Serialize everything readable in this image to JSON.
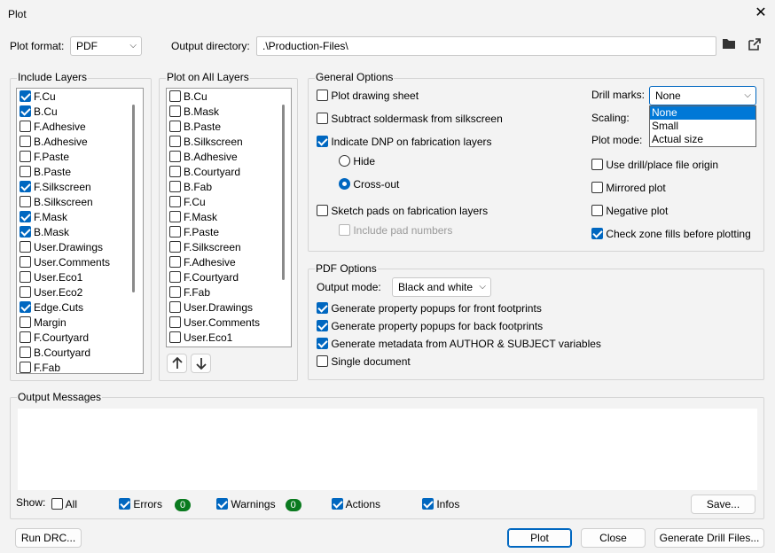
{
  "window": {
    "title": "Plot"
  },
  "top": {
    "plot_format_label": "Plot format:",
    "plot_format_value": "PDF",
    "output_dir_label": "Output directory:",
    "output_dir_value": ".\\Production-Files\\"
  },
  "include_layers": {
    "title": "Include Layers",
    "items": [
      {
        "label": "F.Cu",
        "checked": true
      },
      {
        "label": "B.Cu",
        "checked": true
      },
      {
        "label": "F.Adhesive",
        "checked": false
      },
      {
        "label": "B.Adhesive",
        "checked": false
      },
      {
        "label": "F.Paste",
        "checked": false
      },
      {
        "label": "B.Paste",
        "checked": false
      },
      {
        "label": "F.Silkscreen",
        "checked": true
      },
      {
        "label": "B.Silkscreen",
        "checked": false
      },
      {
        "label": "F.Mask",
        "checked": true
      },
      {
        "label": "B.Mask",
        "checked": true
      },
      {
        "label": "User.Drawings",
        "checked": false
      },
      {
        "label": "User.Comments",
        "checked": false
      },
      {
        "label": "User.Eco1",
        "checked": false
      },
      {
        "label": "User.Eco2",
        "checked": false
      },
      {
        "label": "Edge.Cuts",
        "checked": true
      },
      {
        "label": "Margin",
        "checked": false
      },
      {
        "label": "F.Courtyard",
        "checked": false
      },
      {
        "label": "B.Courtyard",
        "checked": false
      },
      {
        "label": "F.Fab",
        "checked": false
      }
    ]
  },
  "plot_all_layers": {
    "title": "Plot on All Layers",
    "items": [
      {
        "label": "B.Cu",
        "checked": false
      },
      {
        "label": "B.Mask",
        "checked": false
      },
      {
        "label": "B.Paste",
        "checked": false
      },
      {
        "label": "B.Silkscreen",
        "checked": false
      },
      {
        "label": "B.Adhesive",
        "checked": false
      },
      {
        "label": "B.Courtyard",
        "checked": false
      },
      {
        "label": "B.Fab",
        "checked": false
      },
      {
        "label": "F.Cu",
        "checked": false
      },
      {
        "label": "F.Mask",
        "checked": false
      },
      {
        "label": "F.Paste",
        "checked": false
      },
      {
        "label": "F.Silkscreen",
        "checked": false
      },
      {
        "label": "F.Adhesive",
        "checked": false
      },
      {
        "label": "F.Courtyard",
        "checked": false
      },
      {
        "label": "F.Fab",
        "checked": false
      },
      {
        "label": "User.Drawings",
        "checked": false
      },
      {
        "label": "User.Comments",
        "checked": false
      },
      {
        "label": "User.Eco1",
        "checked": false
      }
    ]
  },
  "general": {
    "title": "General Options",
    "plot_drawing_sheet": "Plot drawing sheet",
    "subtract_soldermask": "Subtract soldermask from silkscreen",
    "indicate_dnp": "Indicate DNP on fabrication layers",
    "hide": "Hide",
    "cross_out": "Cross-out",
    "sketch_pads": "Sketch pads on fabrication layers",
    "include_pad_numbers": "Include pad numbers",
    "drill_marks_label": "Drill marks:",
    "drill_marks_value": "None",
    "drill_options": [
      "None",
      "Small",
      "Actual size"
    ],
    "scaling_label": "Scaling:",
    "plot_mode_label": "Plot mode:",
    "use_drill_origin": "Use drill/place file origin",
    "mirrored_plot": "Mirrored plot",
    "negative_plot": "Negative plot",
    "check_zone_fills": "Check zone fills before plotting"
  },
  "pdf": {
    "title": "PDF Options",
    "output_mode_label": "Output mode:",
    "output_mode_value": "Black and white",
    "front_popups": "Generate property popups for front footprints",
    "back_popups": "Generate property popups for back footprints",
    "metadata": "Generate metadata from AUTHOR & SUBJECT variables",
    "single_document": "Single document"
  },
  "messages": {
    "title": "Output Messages",
    "show_label": "Show:",
    "all": "All",
    "errors": "Errors",
    "errors_count": "0",
    "warnings": "Warnings",
    "warnings_count": "0",
    "actions": "Actions",
    "infos": "Infos",
    "save": "Save..."
  },
  "footer": {
    "run_drc": "Run DRC...",
    "plot": "Plot",
    "close": "Close",
    "generate_drill": "Generate Drill Files..."
  },
  "colors": {
    "accent": "#0067c0",
    "badge": "#0a7a1f"
  },
  "icons": {
    "folder": "folder-icon",
    "open_external": "open-external-icon",
    "up": "arrow-up-icon",
    "down": "arrow-down-icon",
    "close": "close-icon"
  }
}
